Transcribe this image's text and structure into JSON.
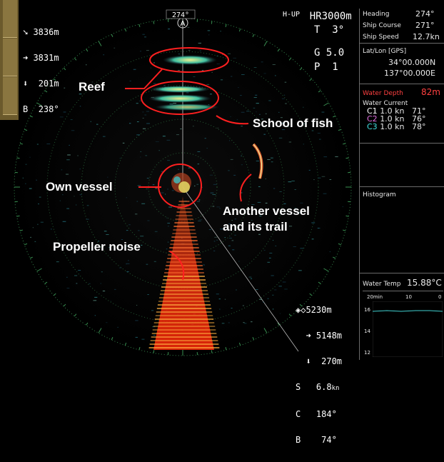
{
  "colors": {
    "ring": "#3fa05a",
    "annotation": "#ff2020",
    "accent_red": "#ff2020",
    "bg": "#000000"
  },
  "top_left": {
    "r1": "3836m",
    "r2": "3831m",
    "r3": "201m",
    "r4": "238°"
  },
  "bearing_label": "274°",
  "north_marker": "A",
  "top_right": {
    "mode": "H-UP",
    "range": "HR3000m",
    "tilt": "T  3°",
    "gain": "G 5.0",
    "pulse": "P  1"
  },
  "bottom_right": {
    "r1": "5230m",
    "r2": "5148m",
    "r3": "270m",
    "speed_label": "S",
    "speed_val": "6.8",
    "speed_unit": "kn",
    "course_label": "C",
    "course_val": "184°",
    "bearing_label": "B",
    "bearing_val": "74°"
  },
  "panel": {
    "heading_label": "Heading",
    "heading_val": "274°",
    "course_label": "Ship Course",
    "course_val": "271°",
    "speed_label": "Ship Speed",
    "speed_val": "12.7kn",
    "latlon_label": "Lat/Lon [GPS]",
    "lat": "34°00.000N",
    "lon": "137°00.000E",
    "depth_label": "Water Depth",
    "depth_val": "82m",
    "current_label": "Water Current",
    "currents": [
      {
        "name": "C1",
        "speed": "1.0 kn",
        "dir": "71°",
        "color": "#ffffff"
      },
      {
        "name": "C2",
        "speed": "1.0 kn",
        "dir": "76°",
        "color": "#e070e0"
      },
      {
        "name": "C3",
        "speed": "1.0 kn",
        "dir": "78°",
        "color": "#40e0e0"
      }
    ],
    "histogram_label": "Histogram",
    "temp_label": "Water Temp",
    "temp_val": "15.88°C",
    "graph_x": [
      "20min",
      "10",
      "0"
    ],
    "graph_y": [
      "16",
      "14",
      "12"
    ]
  },
  "annotations": {
    "reef": "Reef",
    "fish": "School of fish",
    "own": "Own vessel",
    "other1": "Another vessel",
    "other2": "and its trail",
    "prop": "Propeller noise"
  }
}
